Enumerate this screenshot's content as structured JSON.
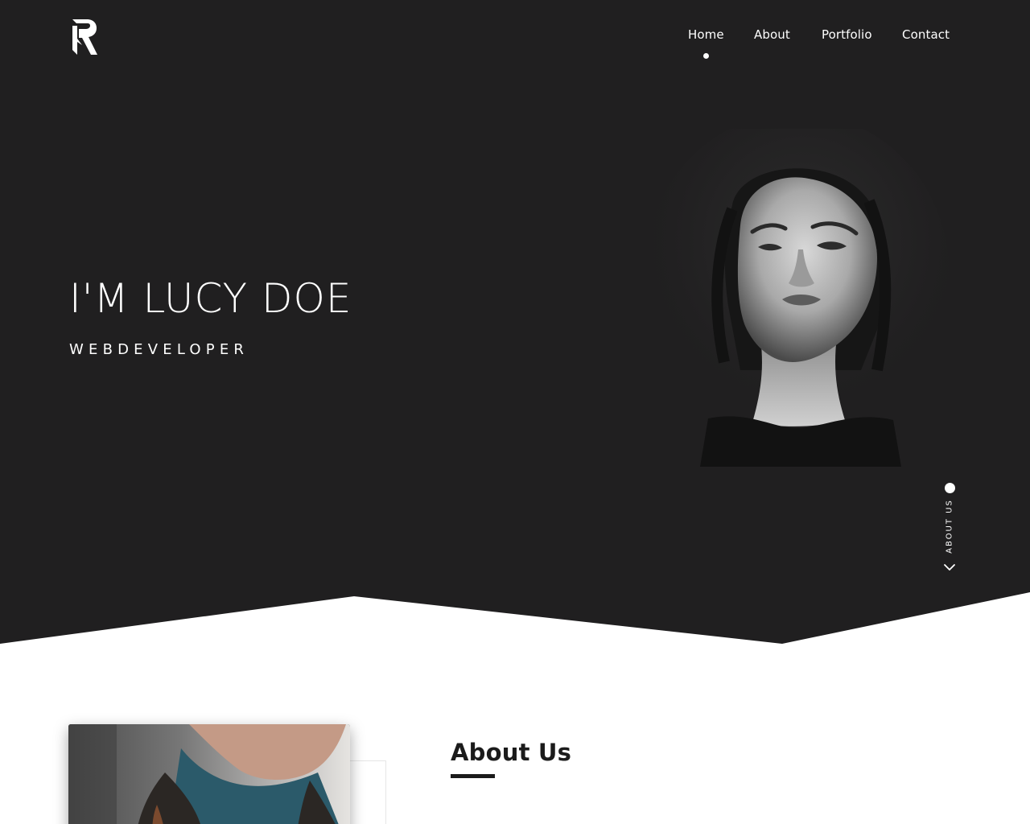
{
  "brand": {
    "logo_icon": "r-monogram-logo"
  },
  "nav": {
    "items": [
      {
        "label": "Home",
        "active": true
      },
      {
        "label": "About",
        "active": false
      },
      {
        "label": "Portfolio",
        "active": false
      },
      {
        "label": "Contact",
        "active": false
      }
    ]
  },
  "hero": {
    "name": "I'M LUCY DOE",
    "role": "WEBDEVELOPER",
    "portrait_icon": "portrait-photo",
    "scroll_hint": {
      "label": "ABOUT US",
      "icon": "chevron-down-icon"
    }
  },
  "about": {
    "title": "About Us",
    "photo_icon": "man-portrait-photo"
  },
  "colors": {
    "hero_background": "#201f20",
    "text_light": "#ffffff",
    "text_dark": "#1b1b1b",
    "page_background": "#ffffff"
  }
}
